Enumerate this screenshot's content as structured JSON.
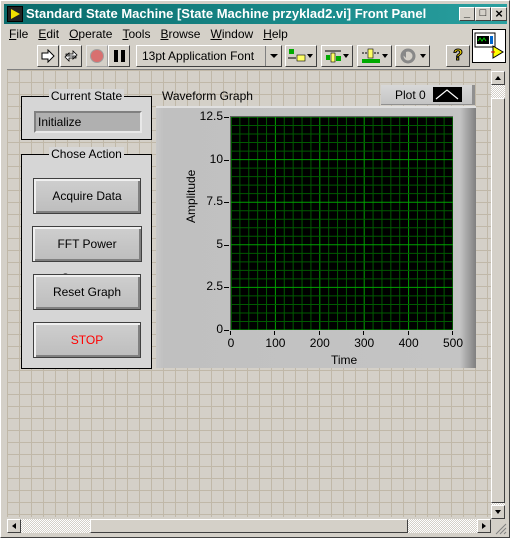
{
  "window": {
    "title": "Standard State Machine [State Machine przyklad2.vi] Front Panel",
    "minimize_label": "_",
    "maximize_label": "□",
    "close_label": "×"
  },
  "menubar": {
    "items": [
      {
        "label": "File",
        "accel": "F",
        "rest": "ile"
      },
      {
        "label": "Edit",
        "accel": "E",
        "rest": "dit"
      },
      {
        "label": "Operate",
        "accel": "O",
        "rest": "perate"
      },
      {
        "label": "Tools",
        "accel": "T",
        "rest": "ools"
      },
      {
        "label": "Browse",
        "accel": "B",
        "rest": "rowse"
      },
      {
        "label": "Window",
        "accel": "W",
        "rest": "indow"
      },
      {
        "label": "Help",
        "accel": "H",
        "rest": "elp"
      }
    ]
  },
  "toolbar": {
    "font_selector": "13pt Application Font",
    "buttons": [
      "run-icon",
      "run-continuously-icon",
      "abort-icon",
      "pause-icon",
      "align-objects-icon",
      "distribute-objects-icon",
      "resize-objects-icon",
      "reorder-icon",
      "context-help-icon"
    ],
    "help_label": "?"
  },
  "panel": {
    "current_state": {
      "label": "Current State",
      "value": "Initialize"
    },
    "actions": {
      "label": "Chose Action",
      "buttons": [
        {
          "label": "Acquire Data",
          "color": "#000000"
        },
        {
          "label": "FFT Power Spectrum",
          "color": "#000000"
        },
        {
          "label": "Reset Graph",
          "color": "#000000"
        },
        {
          "label": "STOP",
          "color": "#ff0000"
        }
      ]
    },
    "graph": {
      "label": "Waveform Graph",
      "legend": "Plot 0"
    }
  },
  "chart_data": {
    "type": "line",
    "title": "Waveform Graph",
    "xlabel": "Time",
    "ylabel": "Amplitude",
    "xlim": [
      0,
      500
    ],
    "ylim": [
      0,
      12.5
    ],
    "x_ticks": [
      "0",
      "100",
      "200",
      "300",
      "400",
      "500"
    ],
    "y_ticks": [
      "0",
      "2.5",
      "5",
      "7.5",
      "10",
      "12.5"
    ],
    "grid": true,
    "grid_color": "#00a000",
    "background": "#000000",
    "legend_position": "top-right",
    "series": [
      {
        "name": "Plot 0",
        "values": []
      }
    ]
  }
}
